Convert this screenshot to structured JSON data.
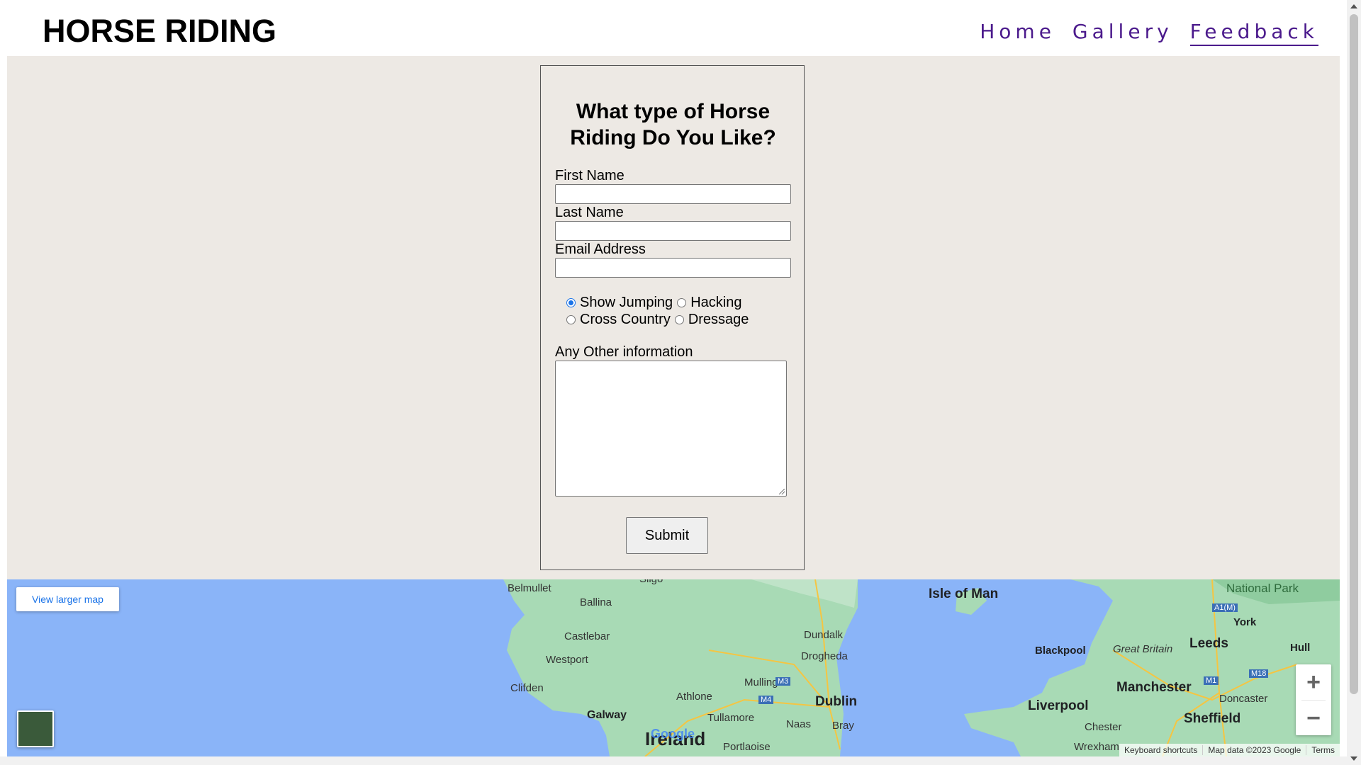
{
  "header": {
    "site_title": "HORSE RIDING",
    "nav": [
      "Home",
      "Gallery",
      "Feedback"
    ]
  },
  "form": {
    "heading": "What type of Horse Riding Do You Like?",
    "first_name_label": "First Name",
    "last_name_label": "Last Name",
    "email_label": "Email Address",
    "first_name_value": "",
    "last_name_value": "",
    "email_value": "",
    "riding_options": [
      "Show Jumping",
      "Hacking",
      "Cross Country",
      "Dressage"
    ],
    "selected_option": "Show Jumping",
    "other_info_label": "Any Other information",
    "other_info_value": "",
    "submit_label": "Submit"
  },
  "map": {
    "view_larger": "View larger map",
    "labels": [
      "Belmullet",
      "Ballina",
      "Castlebar",
      "Westport",
      "Clifden",
      "Galway",
      "Ireland",
      "Athlone",
      "Mullingar",
      "Tullamore",
      "Portlaoise",
      "Dundalk",
      "Drogheda",
      "Dublin",
      "Naas",
      "Bray",
      "Sligo",
      "Isle of Man",
      "Blackpool",
      "Great Britain",
      "Liverpool",
      "Chester",
      "Wrexham",
      "Manchester",
      "Leeds",
      "York",
      "Hull",
      "Doncaster",
      "Sheffield",
      "National Park",
      "M4",
      "M3",
      "M1",
      "M18",
      "A1(M)"
    ],
    "zoom_in": "+",
    "zoom_out": "−",
    "attribution": [
      "Keyboard shortcuts",
      "Map data ©2023 Google",
      "Terms"
    ],
    "google": "Google"
  },
  "colors": {
    "nav": "#4b1a8c",
    "main_bg": "#ede9e4",
    "water": "#8ab4f8",
    "land": "#a8dab5"
  }
}
